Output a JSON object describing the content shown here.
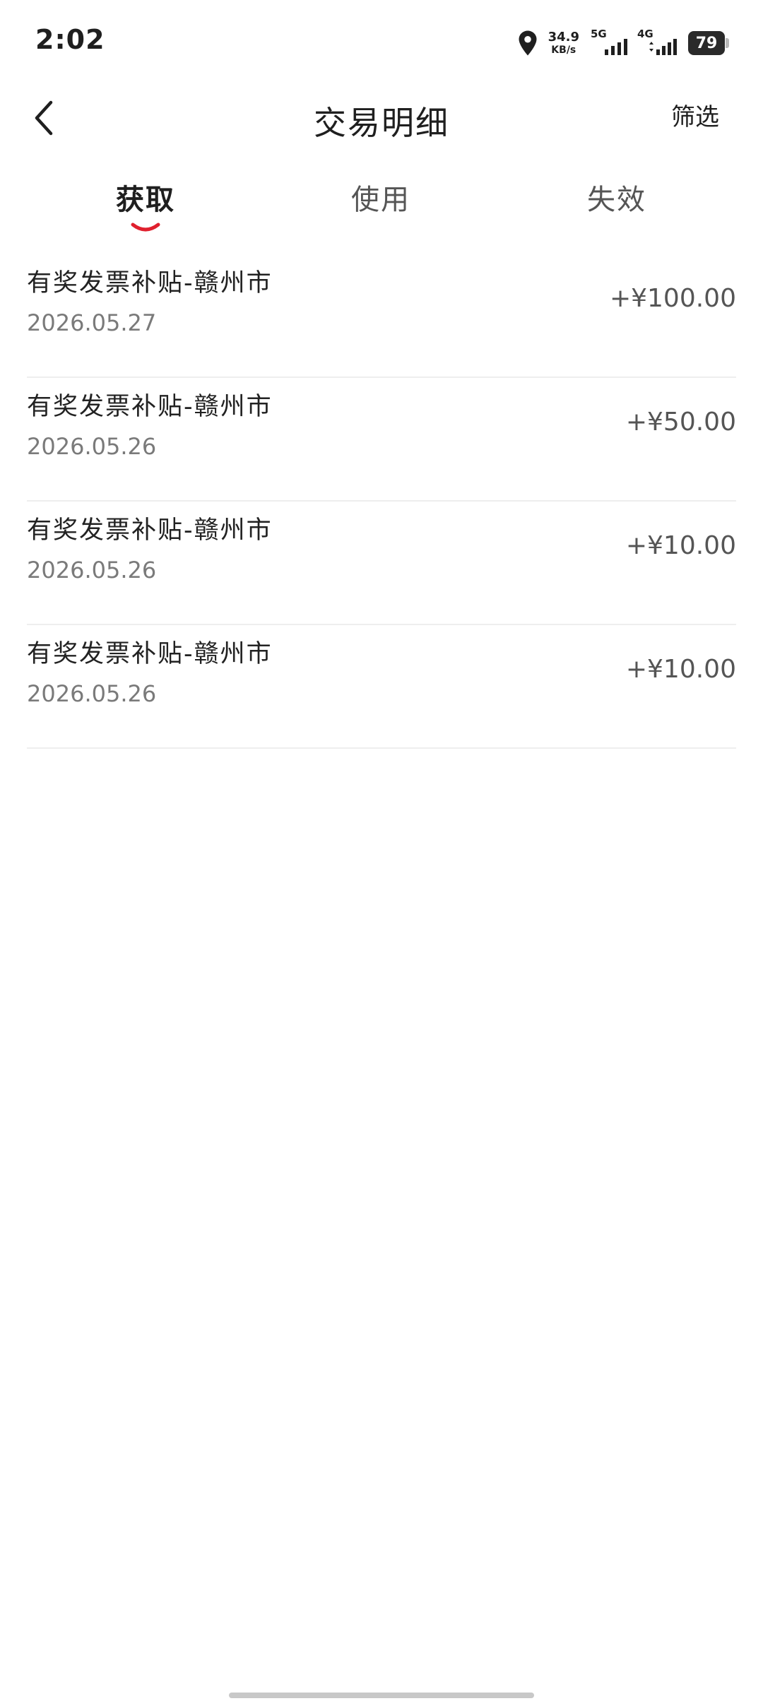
{
  "status_bar": {
    "time": "2:02",
    "net_speed_value": "34.9",
    "net_speed_unit": "KB/s",
    "sim1_type": "5G",
    "sim2_type": "4G",
    "battery": "79",
    "icons": [
      "location-icon",
      "signal-5g-icon",
      "signal-4g-icon",
      "battery-icon"
    ]
  },
  "header": {
    "title": "交易明细",
    "filter_label": "筛选",
    "back_icon": "chevron-left-icon"
  },
  "tabs": [
    {
      "label": "获取",
      "active": true
    },
    {
      "label": "使用",
      "active": false
    },
    {
      "label": "失效",
      "active": false
    }
  ],
  "transactions": [
    {
      "title": "有奖发票补贴-赣州市",
      "date": "2026.05.27",
      "amount": "+¥100.00"
    },
    {
      "title": "有奖发票补贴-赣州市",
      "date": "2026.05.26",
      "amount": "+¥50.00"
    },
    {
      "title": "有奖发票补贴-赣州市",
      "date": "2026.05.26",
      "amount": "+¥10.00"
    },
    {
      "title": "有奖发票补贴-赣州市",
      "date": "2026.05.26",
      "amount": "+¥10.00"
    }
  ],
  "colors": {
    "accent": "#e0202e",
    "text_primary": "#222222",
    "text_secondary": "#7a7a7a",
    "divider": "#eeeeee"
  }
}
